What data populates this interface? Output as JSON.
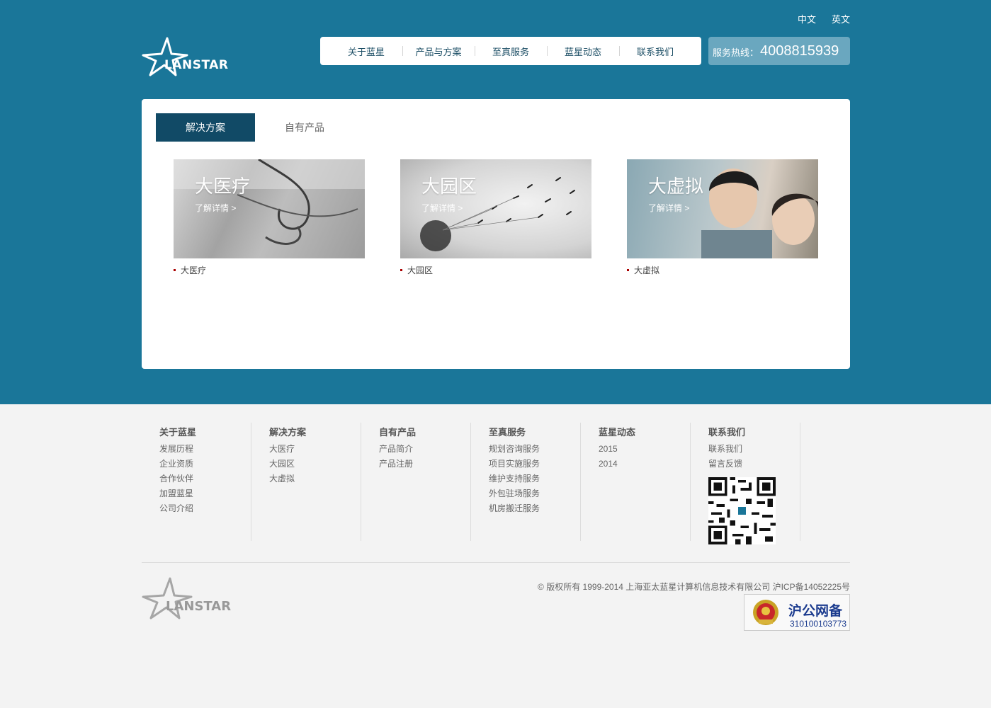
{
  "header": {
    "lang": [
      "中文",
      "英文"
    ],
    "logo_text": "LANSTAR",
    "nav": [
      "关于蓝星",
      "产品与方案",
      "至真服务",
      "蓝星动态",
      "联系我们"
    ],
    "hotline_label": "服务热线：",
    "hotline_number": "4008815939"
  },
  "panel": {
    "tabs": [
      "解决方案",
      "自有产品"
    ],
    "cards": [
      {
        "title": "大医疗",
        "more": "了解详情 >",
        "caption": "大医疗"
      },
      {
        "title": "大园区",
        "more": "了解详情 >",
        "caption": "大园区"
      },
      {
        "title": "大虚拟",
        "more": "了解详情 >",
        "caption": "大虚拟"
      }
    ]
  },
  "footer": {
    "columns": [
      {
        "title": "关于蓝星",
        "links": [
          "发展历程",
          "企业资质",
          "合作伙伴",
          "加盟蓝星",
          "公司介绍"
        ]
      },
      {
        "title": "解决方案",
        "links": [
          "大医疗",
          "大园区",
          "大虚拟"
        ]
      },
      {
        "title": "自有产品",
        "links": [
          "产品简介",
          "产品注册"
        ]
      },
      {
        "title": "至真服务",
        "links": [
          "规划咨询服务",
          "项目实施服务",
          "维护支持服务",
          "外包驻场服务",
          "机房搬迁服务"
        ]
      },
      {
        "title": "蓝星动态",
        "links": [
          "2015",
          "2014"
        ]
      },
      {
        "title": "联系我们",
        "links": [
          "联系我们",
          "留言反馈"
        ]
      }
    ],
    "logo_text": "LANSTAR",
    "copyright": "© 版权所有 1999-2014 上海亚太蓝星计算机信息技术有限公司 沪ICP备14052225号",
    "badge_title": "沪公网备",
    "badge_number": "310100103773"
  },
  "colors": {
    "brand": "#1a7699",
    "tab_active": "#114a66",
    "hotline_bg": "#6aa7bf"
  }
}
